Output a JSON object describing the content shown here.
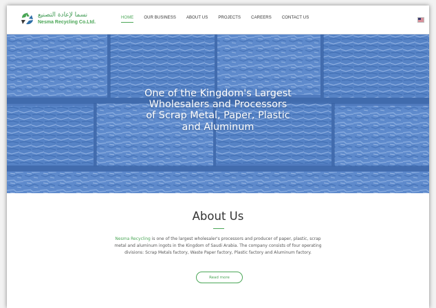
{
  "header": {
    "logo_ar": "نسما لإعادة التصنيع",
    "logo_en": "Nesma Recycling Co.Ltd.",
    "nav": [
      {
        "label": "HOME",
        "active": true
      },
      {
        "label": "OUR BUSINESS",
        "active": false
      },
      {
        "label": "ABOUT US",
        "active": false
      },
      {
        "label": "PROJECTS",
        "active": false
      },
      {
        "label": "CAREERS",
        "active": false
      },
      {
        "label": "CONTACT US",
        "active": false
      }
    ],
    "language_flag": "us-flag-icon"
  },
  "hero": {
    "title": "One of the Kingdom's Largest Wholesalers and Processors of Scrap Metal, Paper, Plastic and Aluminum"
  },
  "about": {
    "title": "About Us",
    "brand": "Nesma Recycling",
    "text": " is one of the largest wholesaler's processors and producer of paper, plastic, scrap metal and aluminum ingots in the Kingdom of Saudi Arabia. The company consists of four operating divisions: Scrap Metals factory, Waste Paper factory, Plastic factory and Aluminum factory.",
    "read_more": "Read more"
  },
  "colors": {
    "accent": "#4aa656",
    "hero_overlay": "#5a86c5"
  }
}
